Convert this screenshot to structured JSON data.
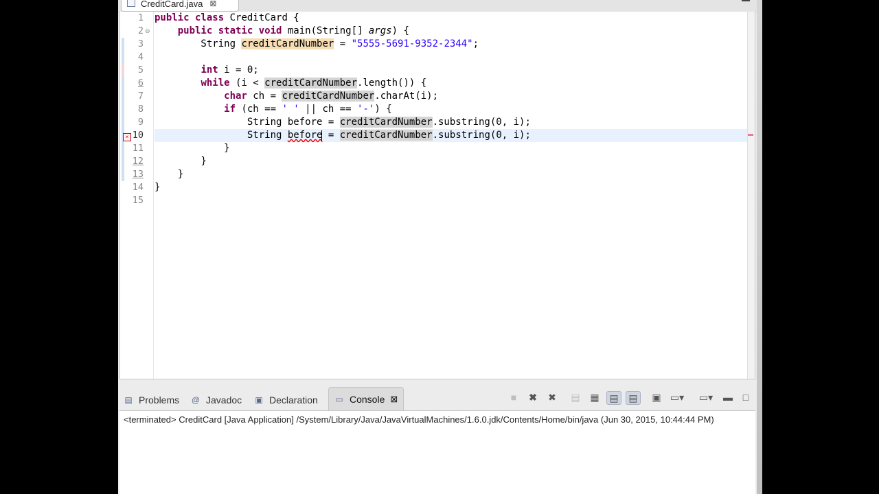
{
  "editor": {
    "tab_label": "CreditCard.java",
    "tab_close": "⊠"
  },
  "code_lines": [
    {
      "n": "1",
      "text": "public class CreditCard {"
    },
    {
      "n": "2",
      "text": "    public static void main(String[] args) {"
    },
    {
      "n": "3",
      "text": "        String creditCardNumber = \"5555-5691-9352-2344\";"
    },
    {
      "n": "4",
      "text": ""
    },
    {
      "n": "5",
      "text": "        int i = 0;"
    },
    {
      "n": "6",
      "text": "        while (i < creditCardNumber.length()) {"
    },
    {
      "n": "7",
      "text": "            char ch = creditCardNumber.charAt(i);"
    },
    {
      "n": "8",
      "text": "            if (ch == ' ' || ch == '-') {"
    },
    {
      "n": "9",
      "text": "                String before = creditCardNumber.substring(0, i);"
    },
    {
      "n": "10",
      "text": "                String before = creditCardNumber.substring(0, i);"
    },
    {
      "n": "11",
      "text": "            }"
    },
    {
      "n": "12",
      "text": "        }"
    },
    {
      "n": "13",
      "text": "    }"
    },
    {
      "n": "14",
      "text": "}"
    },
    {
      "n": "15",
      "text": ""
    }
  ],
  "console": {
    "tabs": [
      {
        "label": "Problems",
        "icon": "problems-icon"
      },
      {
        "label": "Javadoc",
        "icon": "at-icon"
      },
      {
        "label": "Declaration",
        "icon": "declaration-icon"
      },
      {
        "label": "Console",
        "icon": "console-icon"
      }
    ],
    "close_glyph": "⊠",
    "status": "<terminated> CreditCard [Java Application] /System/Library/Java/JavaVirtualMachines/1.6.0.jdk/Contents/Home/bin/java (Jun 30, 2015, 10:44:44 PM)"
  }
}
